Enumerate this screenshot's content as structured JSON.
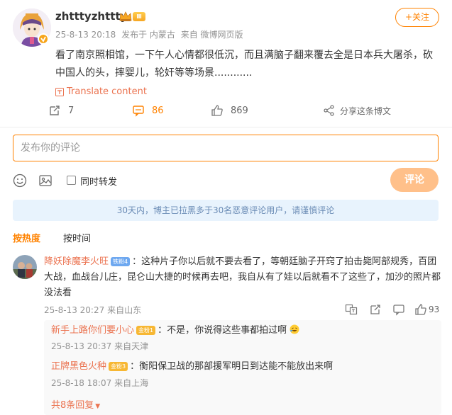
{
  "post": {
    "username": "zhtttyzhttty",
    "level_badge": "Ⅲ",
    "date": "25-8-13 20:18",
    "location": "发布于 内蒙古",
    "source": "来自 微博网页版",
    "follow_label": "+关注",
    "text": "看了南京照相馆，一下午人心情都很低沉，而且满脑子翻来覆去全是日本兵大屠杀，砍中国人的头，摔婴儿，轮奸等等场景............",
    "translate_label": "Translate content",
    "reposts": "7",
    "comments": "86",
    "likes": "869",
    "share_label": "分享这条博文"
  },
  "composer": {
    "placeholder": "发布你的评论",
    "repost_checkbox_label": "同时转发",
    "submit_label": "评论"
  },
  "notice": "30天内，博主已拉黑多于30名恶意评论用户，请谨慎评论",
  "tabs": [
    {
      "label": "按热度"
    },
    {
      "label": "按时间"
    }
  ],
  "comment": {
    "author": "降妖除魔李火旺",
    "fan_badge": "铁粉4",
    "text": "：这种片子你以后就不要去看了，等朝廷脑子开窍了拍击毙阿部规秀，百团大战，血战台儿庄，昆仑山大捷的时候再去吧，我自从有了娃以后就看不了这些了，加沙的照片都没法看",
    "date": "25-8-13 20:27",
    "location": "来自山东",
    "likes": "93"
  },
  "replies": [
    {
      "author": "新手上路你们要小心",
      "badge": "金粉1",
      "text": "：不是，你说得这些事都拍过啊",
      "date": "25-8-13 20:37",
      "location": "来自天津"
    },
    {
      "author": "正牌黑色火种",
      "badge": "金粉3",
      "text": "：衡阳保卫战的那部援军明日到达能不能放出来啊",
      "date": "25-8-18 18:07",
      "location": "来自上海"
    }
  ],
  "more_replies_label": "共8条回复",
  "colors": {
    "accent": "#ff8200",
    "name": "#eb7350",
    "notice_bg": "#e8f3fd",
    "meta": "#939393"
  }
}
